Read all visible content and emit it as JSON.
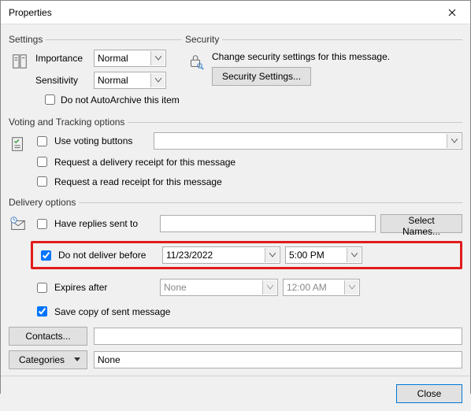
{
  "window": {
    "title": "Properties"
  },
  "settings": {
    "legend": "Settings",
    "importance_label": "Importance",
    "importance_value": "Normal",
    "sensitivity_label": "Sensitivity",
    "sensitivity_value": "Normal",
    "autoarchive_label": "Do not AutoArchive this item",
    "autoarchive_checked": false
  },
  "security": {
    "legend": "Security",
    "text": "Change security settings for this message.",
    "button": "Security Settings..."
  },
  "voting": {
    "legend": "Voting and Tracking options",
    "use_voting_label": "Use voting buttons",
    "use_voting_checked": false,
    "voting_value": "",
    "delivery_receipt_label": "Request a delivery receipt for this message",
    "delivery_receipt_checked": false,
    "read_receipt_label": "Request a read receipt for this message",
    "read_receipt_checked": false
  },
  "delivery": {
    "legend": "Delivery options",
    "have_replies_label": "Have replies sent to",
    "have_replies_checked": false,
    "have_replies_value": "",
    "select_names_button": "Select Names...",
    "do_not_deliver_label": "Do not deliver before",
    "do_not_deliver_checked": true,
    "do_not_deliver_date": "11/23/2022",
    "do_not_deliver_time": "5:00 PM",
    "expires_label": "Expires after",
    "expires_checked": false,
    "expires_date": "None",
    "expires_time": "12:00 AM",
    "save_copy_label": "Save copy of sent message",
    "save_copy_checked": true
  },
  "bottom": {
    "contacts_button": "Contacts...",
    "contacts_value": "",
    "categories_button": "Categories",
    "categories_value": "None"
  },
  "footer": {
    "close": "Close"
  }
}
